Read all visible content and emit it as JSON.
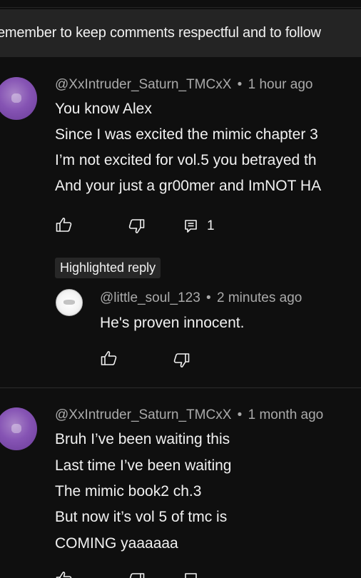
{
  "notice": {
    "text": "emember to keep comments respectful and to follow"
  },
  "comments": [
    {
      "author": "@XxIntruder_Saturn_TMCxX",
      "separator": "•",
      "time": "1 hour ago",
      "lines": [
        "You know Alex",
        "Since I was excited the mimic chapter 3",
        "I’m not excited for vol.5 you betrayed th",
        "And your just a gr00mer and ImNOT HA"
      ],
      "reply_count": "1",
      "avatar_color": "#8654b4"
    },
    {
      "author": "@XxIntruder_Saturn_TMCxX",
      "separator": "•",
      "time": "1 month ago",
      "lines": [
        "Bruh I’ve been waiting this",
        "Last time I’ve been waiting",
        "The mimic book2 ch.3",
        "But now it’s vol 5 of tmc is",
        "COMING yaaaaaa"
      ],
      "avatar_color": "#8654b4"
    }
  ],
  "highlighted": {
    "badge": "Highlighted reply",
    "author": "@little_soul_123",
    "separator": "•",
    "time": "2 minutes ago",
    "text": "He's proven innocent."
  },
  "icons": {
    "like": "thumbs-up-icon",
    "dislike": "thumbs-down-icon",
    "reply": "comment-reply-icon"
  },
  "colors": {
    "background": "#0f0f0f",
    "notice_background": "#242424",
    "meta_text": "#aaaaaa",
    "primary_text": "#f1f1f1",
    "badge_background": "#272727"
  }
}
